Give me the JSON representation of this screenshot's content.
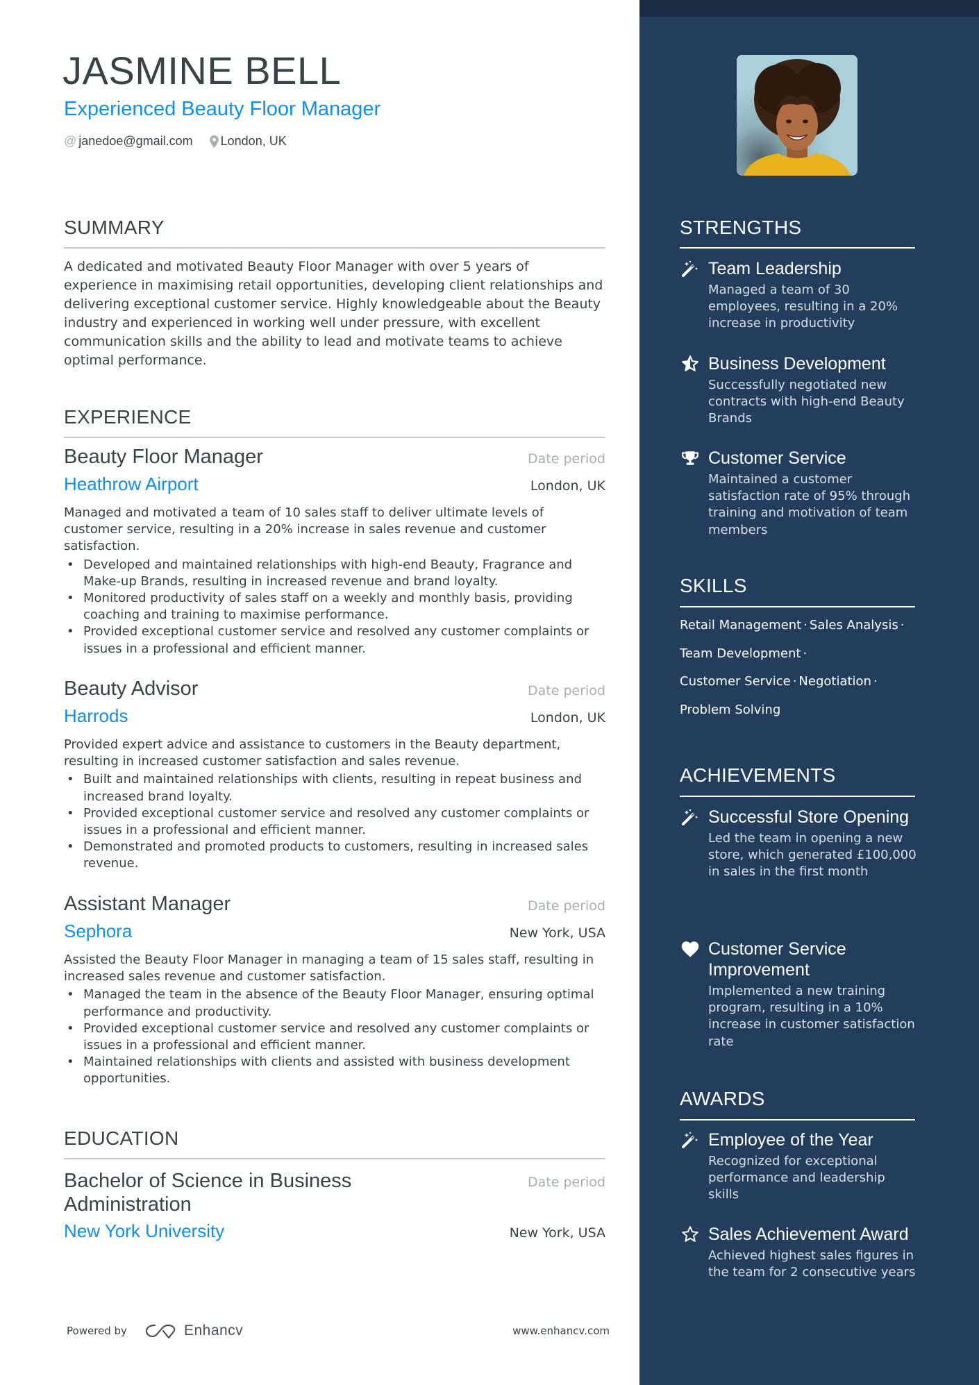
{
  "header": {
    "name": "JASMINE BELL",
    "subtitle": "Experienced Beauty Floor Manager",
    "email": "janedoe@gmail.com",
    "location": "London, UK",
    "email_icon": "at-icon",
    "location_icon": "map-pin-icon"
  },
  "colors": {
    "accent": "#0f8ff2",
    "text": "#384347",
    "muted": "#a8aeb2",
    "sidebar_bg": "#223e5c",
    "sidebar_topband": "#1b2d44"
  },
  "summary": {
    "title": "SUMMARY",
    "text": "A dedicated and motivated Beauty Floor Manager with over 5 years of experience in maximising retail opportunities, developing client relationships and delivering exceptional customer service. Highly knowledgeable about the Beauty industry and experienced in working well under pressure, with excellent communication skills and the ability to lead and motivate teams to achieve optimal performance."
  },
  "experience": {
    "title": "EXPERIENCE",
    "jobs": [
      {
        "title": "Beauty Floor Manager",
        "date": "Date period",
        "company": "Heathrow Airport",
        "location": "London, UK",
        "description": "Managed and motivated a team of 10 sales staff to deliver ultimate levels of customer service, resulting in a 20% increase in sales revenue and customer satisfaction.",
        "bullets": [
          "Developed and maintained relationships with high-end Beauty, Fragrance and Make-up Brands, resulting in increased revenue and brand loyalty.",
          "Monitored productivity of sales staff on a weekly and monthly basis, providing coaching and training to maximise performance.",
          "Provided exceptional customer service and resolved any customer complaints or issues in a professional and efficient manner."
        ]
      },
      {
        "title": "Beauty Advisor",
        "date": "Date period",
        "company": "Harrods",
        "location": "London, UK",
        "description": "Provided expert advice and assistance to customers in the Beauty department, resulting in increased customer satisfaction and sales revenue.",
        "bullets": [
          "Built and maintained relationships with clients, resulting in repeat business and increased brand loyalty.",
          "Provided exceptional customer service and resolved any customer complaints or issues in a professional and efficient manner.",
          "Demonstrated and promoted products to customers, resulting in increased sales revenue."
        ]
      },
      {
        "title": "Assistant Manager",
        "date": "Date period",
        "company": "Sephora",
        "location": "New York, USA",
        "description": "Assisted the Beauty Floor Manager in managing a team of 15 sales staff, resulting in increased sales revenue and customer satisfaction.",
        "bullets": [
          "Managed the team in the absence of the Beauty Floor Manager, ensuring optimal performance and productivity.",
          "Provided exceptional customer service and resolved any customer complaints or issues in a professional and efficient manner.",
          "Maintained relationships with clients and assisted with business development opportunities."
        ]
      }
    ]
  },
  "education": {
    "title": "EDUCATION",
    "items": [
      {
        "degree": "Bachelor of Science in Business Administration",
        "date": "Date period",
        "school": "New York University",
        "location": "New York, USA"
      }
    ]
  },
  "footer": {
    "powered_by": "Powered by",
    "brand": "Enhancv",
    "url": "www.enhancv.com"
  },
  "sidebar": {
    "photo_alt": "Profile photo of smiling woman with curly hair in yellow sweater",
    "strengths": {
      "title": "STRENGTHS",
      "items": [
        {
          "icon": "magic-wand-icon",
          "title": "Team Leadership",
          "description": "Managed a team of 30 employees, resulting in a 20% increase in productivity"
        },
        {
          "icon": "star-half-icon",
          "title": "Business Development",
          "description": "Successfully negotiated new contracts with high-end Beauty Brands"
        },
        {
          "icon": "trophy-icon",
          "title": "Customer Service",
          "description": "Maintained a customer satisfaction rate of 95% through training and motivation of team members"
        }
      ]
    },
    "skills": {
      "title": "SKILLS",
      "lines": [
        [
          "Retail Management",
          "Sales Analysis"
        ],
        [
          "Team Development"
        ],
        [
          "Customer Service",
          "Negotiation"
        ],
        [
          "Problem Solving"
        ]
      ],
      "separator": "·"
    },
    "achievements": {
      "title": "ACHIEVEMENTS",
      "items": [
        {
          "icon": "magic-wand-icon",
          "title": "Successful Store Opening",
          "description": "Led the team in opening a new store, which generated £100,000 in sales in the first month"
        },
        {
          "icon": "heart-icon",
          "title": "Customer Service Improvement",
          "description": "Implemented a new training program, resulting in a 10% increase in customer satisfaction rate"
        }
      ]
    },
    "awards": {
      "title": "AWARDS",
      "items": [
        {
          "icon": "magic-wand-icon",
          "title": "Employee of the Year",
          "description": "Recognized for exceptional performance and leadership skills"
        },
        {
          "icon": "star-outline-icon",
          "title": "Sales Achievement Award",
          "description": "Achieved highest sales figures in the team for 2 consecutive years"
        }
      ]
    }
  }
}
